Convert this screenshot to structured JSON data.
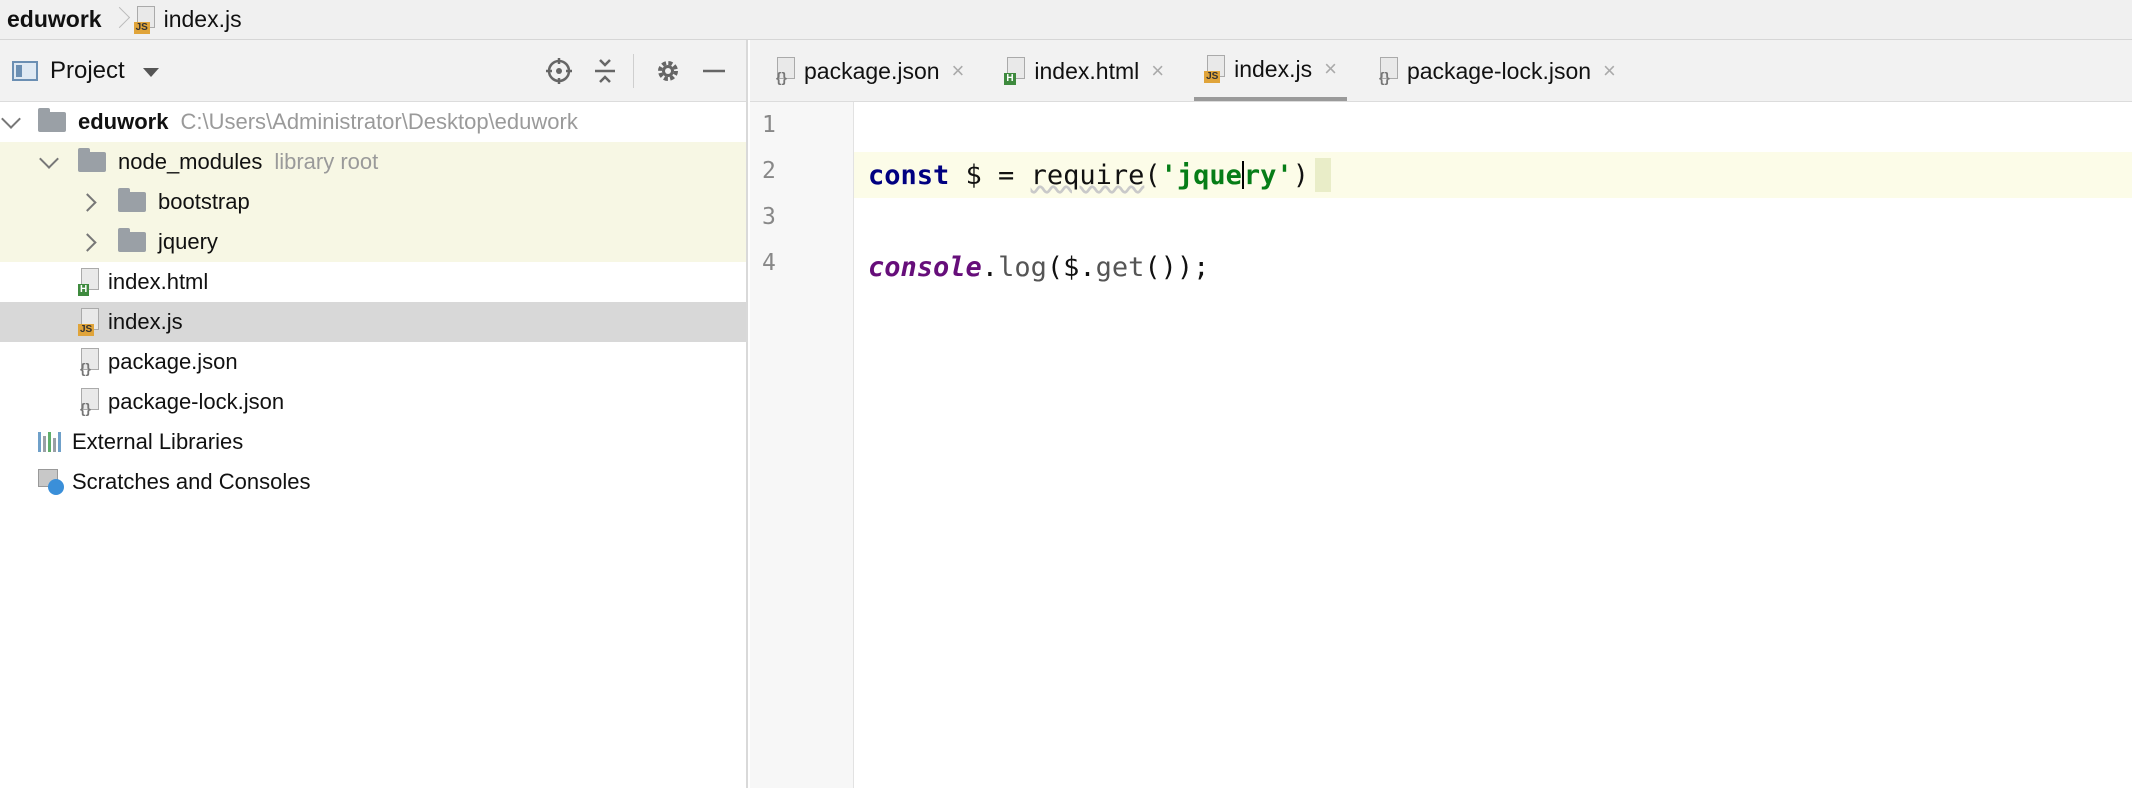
{
  "breadcrumb": {
    "project": "eduwork",
    "file": "index.js"
  },
  "project_pane": {
    "title": "Project",
    "tree": [
      {
        "label": "eduwork",
        "note": "C:\\Users\\Administrator\\Desktop\\eduwork"
      },
      {
        "label": "node_modules",
        "note": "library root"
      },
      {
        "label": "bootstrap"
      },
      {
        "label": "jquery"
      },
      {
        "label": "index.html"
      },
      {
        "label": "index.js"
      },
      {
        "label": "package.json"
      },
      {
        "label": "package-lock.json"
      },
      {
        "label": "External Libraries"
      },
      {
        "label": "Scratches and Consoles"
      }
    ],
    "icons": {
      "locate": "crosshair-icon",
      "collapse": "collapse-all-icon",
      "settings": "gear-icon",
      "hide": "minimize-icon"
    }
  },
  "editor": {
    "tabs": [
      {
        "label": "package.json"
      },
      {
        "label": "index.html"
      },
      {
        "label": "index.js"
      },
      {
        "label": "package-lock.json"
      }
    ],
    "active_tab": "index.js",
    "close_glyph": "×",
    "line_numbers": [
      "1",
      "2",
      "3",
      "4"
    ],
    "code": {
      "line2": {
        "kw": "const",
        "decl": " $ = ",
        "call": "require",
        "open": "(",
        "str_before_cursor": "'jque",
        "str_after_cursor": "ry'",
        "close": ")"
      },
      "line4": {
        "obj": "console",
        "dot": ".",
        "method": "log",
        "rest_open": "($.",
        "get": "get",
        "rest_close": "());"
      }
    }
  },
  "colors": {
    "keyword": "#000080",
    "string": "#067d17",
    "current_line": "#fcfce8",
    "selected_row": "#d8d8d8",
    "library_highlight": "#f7f7e4"
  }
}
